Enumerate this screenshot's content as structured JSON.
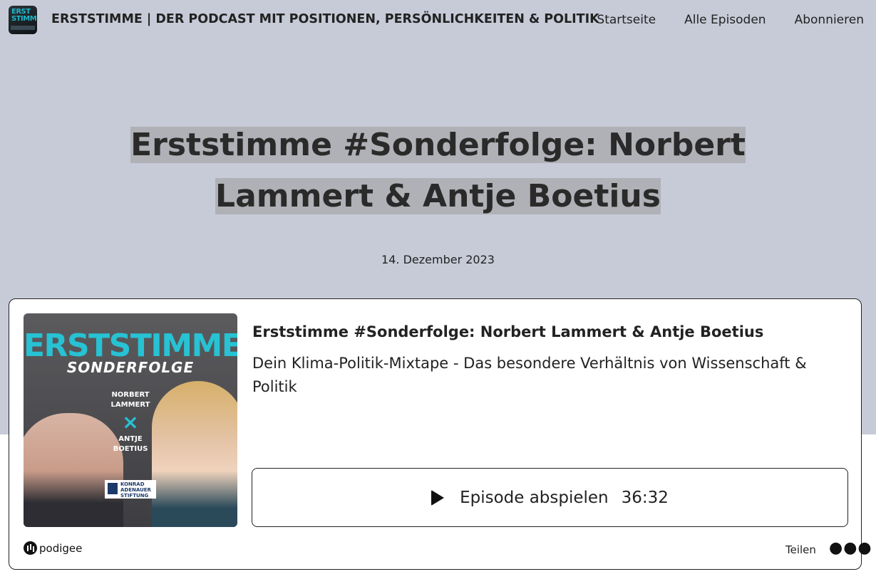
{
  "site": {
    "logo_text": "ERST STIMME",
    "title": "ERSTSTIMME | DER PODCAST MIT POSITIONEN, PERSÖNLICHKEITEN & POLITIK"
  },
  "nav": {
    "items": [
      {
        "label": "Startseite"
      },
      {
        "label": "Alle Episoden"
      },
      {
        "label": "Abonnieren"
      }
    ]
  },
  "hero": {
    "headline": "Erststimme #Sonderfolge: Norbert Lammert & Antje Boetius",
    "date": "14. Dezember 2023",
    "background_color": "#c7cbd8",
    "highlight_color": "#b0b1b6"
  },
  "player": {
    "cover": {
      "brand": "ERSTSTIMME",
      "subtitle": "SONDERFOLGE",
      "name1_line1": "NORBERT",
      "name1_line2": "LAMMERT",
      "separator": "×",
      "name2_line1": "ANTJE",
      "name2_line2": "BOETIUS",
      "org_line1": "KONRAD",
      "org_line2": "ADENAUER",
      "org_line3": "STIFTUNG",
      "accent_color": "#27c2d3"
    },
    "episode_title": "Erststimme #Sonderfolge: Norbert Lammert & Antje Boetius",
    "episode_subtitle": "Dein Klima-Politik-Mixtape - Das besondere Verhältnis von Wissenschaft & Politik",
    "play_label": "Episode abspielen",
    "duration": "36:32",
    "provider": "podigee",
    "share_label": "Teilen",
    "more_icon": "more-dots-icon"
  }
}
